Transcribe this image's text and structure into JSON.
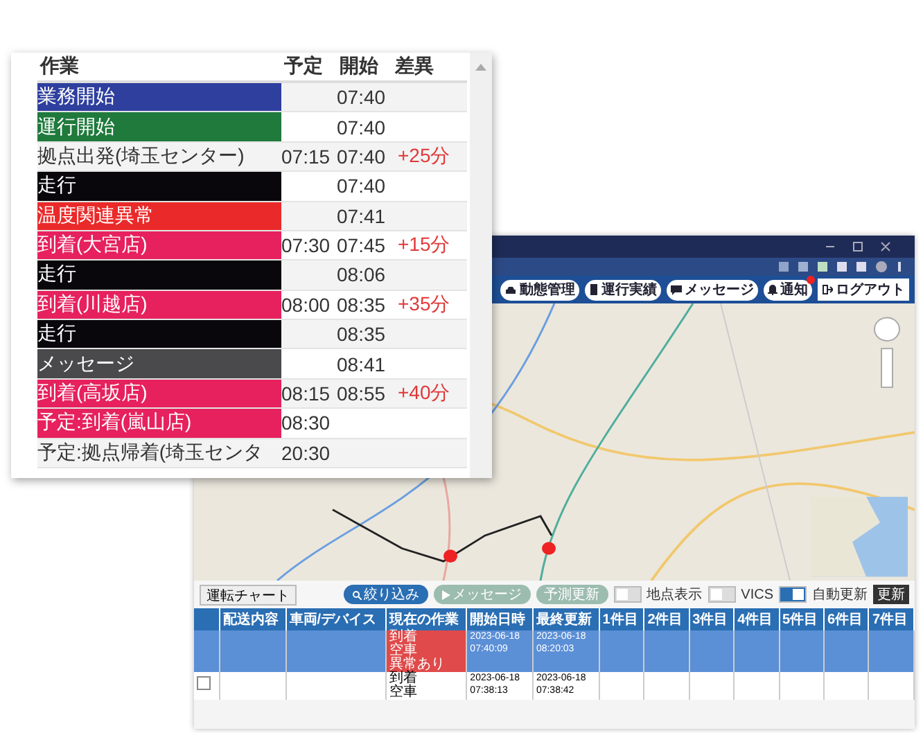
{
  "popup": {
    "columns": [
      "作業",
      "予定",
      "開始",
      "差異"
    ],
    "rows": [
      {
        "label": "業務開始",
        "color": "#2e3f9e",
        "planned": "",
        "start": "07:40",
        "diff": ""
      },
      {
        "label": "運行開始",
        "color": "#1f7a3c",
        "planned": "",
        "start": "07:40",
        "diff": ""
      },
      {
        "label": "拠点出発(埼玉センター)",
        "planned": "07:15",
        "start": "07:40",
        "diff": "+25分"
      },
      {
        "label": "走行",
        "color": "#0a070c",
        "planned": "",
        "start": "07:40",
        "diff": ""
      },
      {
        "label": "温度関連異常",
        "color": "#ea2a2a",
        "planned": "",
        "start": "07:41",
        "diff": ""
      },
      {
        "label": "到着(大宮店)",
        "color": "#e6215e",
        "planned": "07:30",
        "start": "07:45",
        "diff": "+15分"
      },
      {
        "label": "走行",
        "color": "#0a070c",
        "planned": "",
        "start": "08:06",
        "diff": ""
      },
      {
        "label": "到着(川越店)",
        "color": "#e6215e",
        "planned": "08:00",
        "start": "08:35",
        "diff": "+35分"
      },
      {
        "label": "走行",
        "color": "#0a070c",
        "planned": "",
        "start": "08:35",
        "diff": ""
      },
      {
        "label": "メッセージ",
        "color": "#4a4a4c",
        "planned": "",
        "start": "08:41",
        "diff": ""
      },
      {
        "label": "到着(高坂店)",
        "color": "#e6215e",
        "planned": "08:15",
        "start": "08:55",
        "diff": "+40分"
      },
      {
        "label": "予定:到着(嵐山店)",
        "color": "#e6215e",
        "planned": "08:30",
        "start": "",
        "diff": ""
      },
      {
        "label": "予定:拠点帰着(埼玉センタ",
        "planned": "20:30",
        "start": "",
        "diff": ""
      }
    ]
  },
  "app": {
    "nav_buttons": [
      {
        "label": "動態管理",
        "kind": "car"
      },
      {
        "label": "運行実績",
        "kind": "doc"
      },
      {
        "label": "メッセージ",
        "kind": "chat"
      },
      {
        "label": "通知",
        "kind": "bell",
        "badge": true
      }
    ],
    "logout": "ログアウト",
    "chart_button": "運転チャート",
    "filter_button": "絞り込み",
    "message_button": "メッセージ",
    "forecast_button": "予測更新",
    "toggles": [
      {
        "label": "地点表示",
        "on": false
      },
      {
        "label": "VICS",
        "on": false
      },
      {
        "label": "自動更新",
        "on": true
      }
    ],
    "refresh_button": "更新",
    "table": {
      "columns": [
        "配送内容",
        "車両/デバイス",
        "現在の作業",
        "開始日時",
        "最終更新",
        "1件目",
        "2件目",
        "3件目",
        "4件目",
        "5件目",
        "6件目",
        "7件目"
      ],
      "rows": [
        {
          "selected": true,
          "alert": true,
          "work": [
            "到着",
            "空車",
            "異常あり"
          ],
          "started": [
            "2023-06-18",
            "07:40:09"
          ],
          "updated": [
            "2023-06-18",
            "08:20:03"
          ]
        },
        {
          "selected": false,
          "alert": false,
          "work": [
            "到着",
            "空車"
          ],
          "started": [
            "2023-06-18",
            "07:38:13"
          ],
          "updated": [
            "2023-06-18",
            "07:38:42"
          ]
        }
      ]
    }
  }
}
